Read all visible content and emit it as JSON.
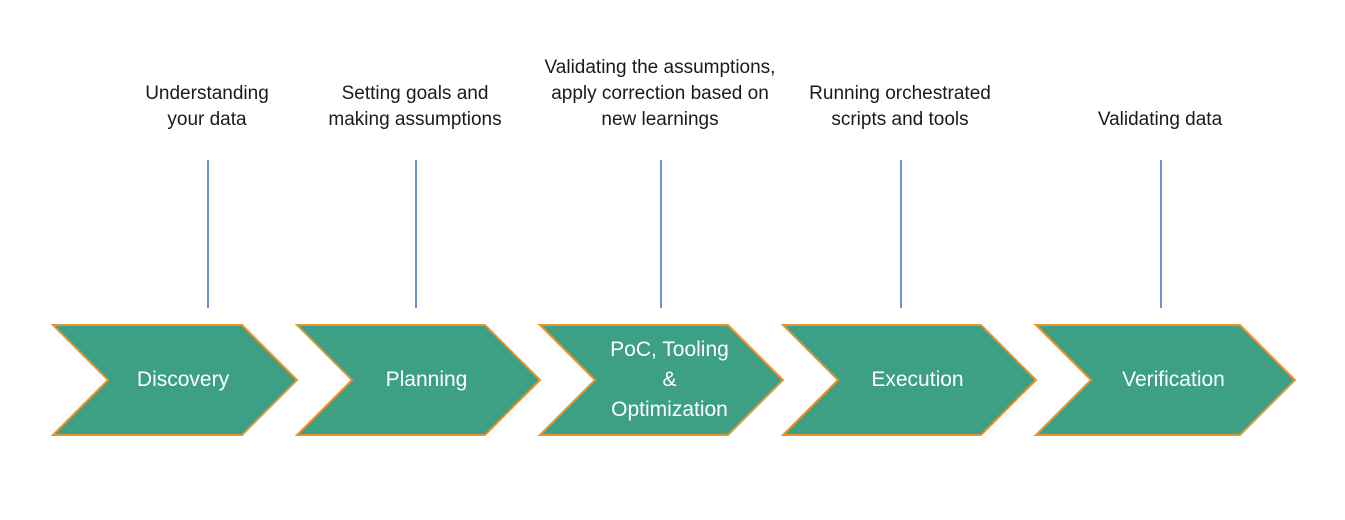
{
  "diagram": {
    "type": "process-flow-chevron",
    "title": "",
    "background_color": "#ffffff",
    "chevron": {
      "fill_color": "#3da084",
      "stroke_color": "#e8942e",
      "text_color": "#ffffff"
    },
    "connector": {
      "color": "#6a93d4"
    },
    "caption": {
      "color": "#1a1a1a"
    },
    "stages": [
      {
        "name": "discovery",
        "chevron_label_lines": [
          "Discovery"
        ],
        "caption_lines": [
          "Understanding",
          "your data"
        ]
      },
      {
        "name": "planning",
        "chevron_label_lines": [
          "Planning"
        ],
        "caption_lines": [
          "Setting goals and",
          "making assumptions"
        ]
      },
      {
        "name": "poc-tooling-optimization",
        "chevron_label_lines": [
          "PoC, Tooling",
          "&",
          "Optimization"
        ],
        "caption_lines": [
          "Validating the assumptions,",
          "apply correction based on",
          "new learnings"
        ]
      },
      {
        "name": "execution",
        "chevron_label_lines": [
          "Execution"
        ],
        "caption_lines": [
          "Running orchestrated",
          "scripts and tools"
        ]
      },
      {
        "name": "verification",
        "chevron_label_lines": [
          "Verification"
        ],
        "caption_lines": [
          "Validating data"
        ]
      }
    ]
  }
}
